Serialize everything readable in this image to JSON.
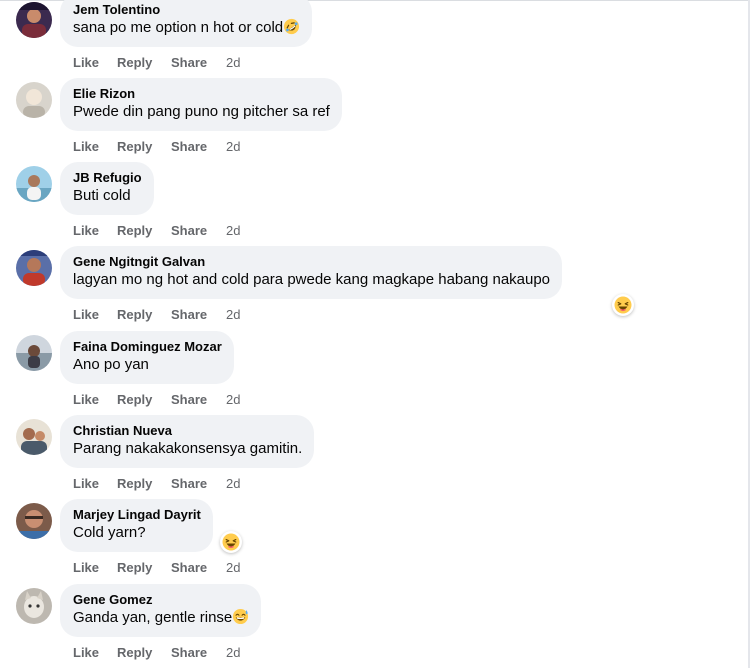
{
  "comments": [
    {
      "author": "Jem Tolentino",
      "text": "sana po me option n hot or cold",
      "text_emoji": "rolling-on-floor-laughing-emoji",
      "reaction": null,
      "actions": {
        "like": "Like",
        "reply": "Reply",
        "share": "Share"
      },
      "time": "2d"
    },
    {
      "author": "Elie Rizon",
      "text": "Pwede din pang puno ng pitcher sa ref",
      "text_emoji": null,
      "reaction": null,
      "actions": {
        "like": "Like",
        "reply": "Reply",
        "share": "Share"
      },
      "time": "2d"
    },
    {
      "author": "JB Refugio",
      "text": "Buti cold",
      "text_emoji": null,
      "reaction": null,
      "actions": {
        "like": "Like",
        "reply": "Reply",
        "share": "Share"
      },
      "time": "2d"
    },
    {
      "author": "Gene Ngitngit Galvan",
      "text": "lagyan mo ng hot and cold para pwede kang magkape habang nakaupo",
      "text_emoji": null,
      "reaction": "haha-reaction-icon",
      "actions": {
        "like": "Like",
        "reply": "Reply",
        "share": "Share"
      },
      "time": "2d"
    },
    {
      "author": "Faina Dominguez Mozar",
      "text": "Ano po yan",
      "text_emoji": null,
      "reaction": null,
      "actions": {
        "like": "Like",
        "reply": "Reply",
        "share": "Share"
      },
      "time": "2d"
    },
    {
      "author": "Christian Nueva",
      "text": "Parang nakakakonsensya gamitin.",
      "text_emoji": null,
      "reaction": null,
      "actions": {
        "like": "Like",
        "reply": "Reply",
        "share": "Share"
      },
      "time": "2d"
    },
    {
      "author": "Marjey Lingad Dayrit",
      "text": "Cold yarn?",
      "text_emoji": null,
      "reaction": "haha-reaction-icon",
      "actions": {
        "like": "Like",
        "reply": "Reply",
        "share": "Share"
      },
      "time": "2d"
    },
    {
      "author": "Gene Gomez",
      "text": "Ganda yan, gentle rinse",
      "text_emoji": "grinning-sweat-emoji",
      "reaction": null,
      "actions": {
        "like": "Like",
        "reply": "Reply",
        "share": "Share"
      },
      "time": "2d"
    }
  ],
  "colors": {
    "bubble": "#f0f2f5",
    "author": "#050505",
    "action": "#65676b",
    "emoji_face": "#ffcc4d"
  }
}
